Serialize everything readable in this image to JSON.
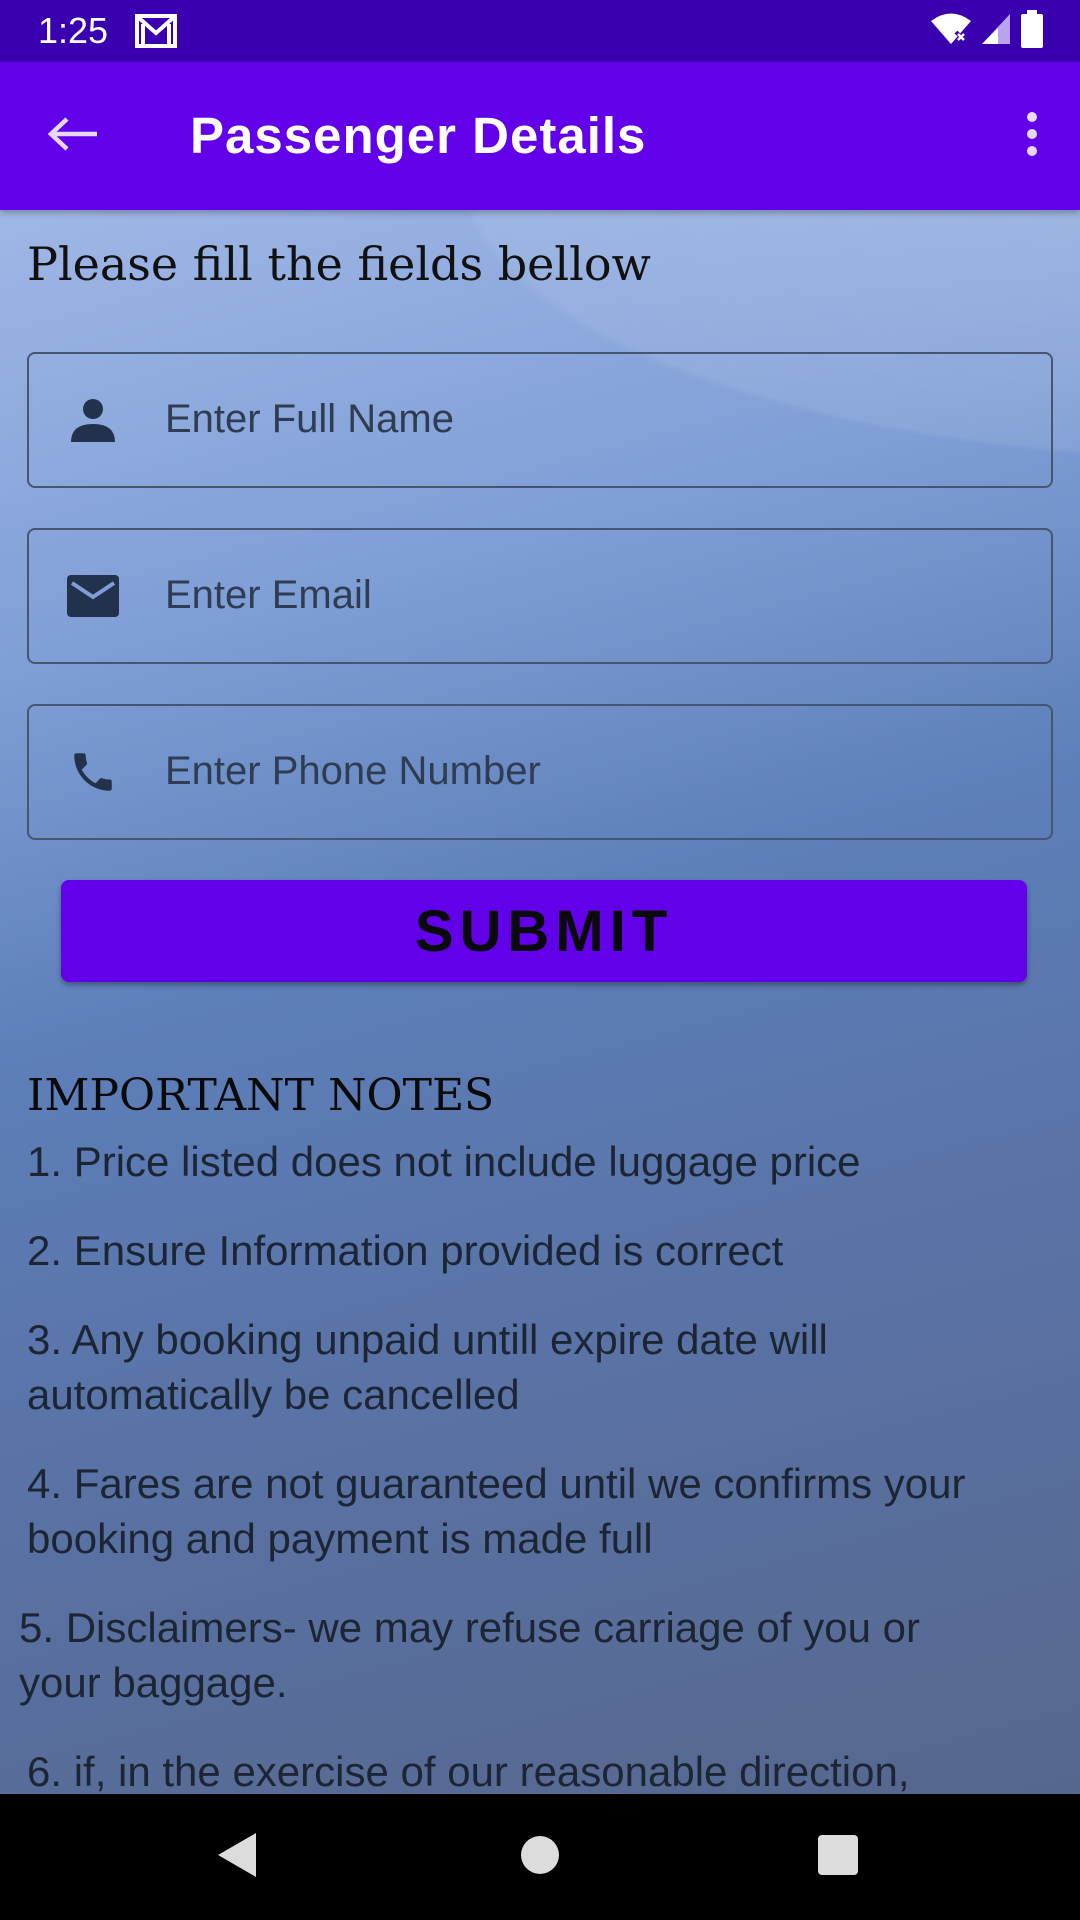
{
  "status_bar": {
    "time": "1:25",
    "icons": [
      "gmail-icon",
      "wifi-icon",
      "signal-icon",
      "battery-icon"
    ]
  },
  "app_bar": {
    "title": "Passenger Details",
    "back_icon": "arrow-back-icon",
    "menu_icon": "more-vert-icon",
    "background_color": "#6200ea"
  },
  "form": {
    "instruction": "Please fill the fields bellow",
    "fields": [
      {
        "icon": "person-icon",
        "placeholder": "Enter Full Name",
        "value": ""
      },
      {
        "icon": "email-icon",
        "placeholder": "Enter Email",
        "value": ""
      },
      {
        "icon": "phone-icon",
        "placeholder": "Enter Phone Number",
        "value": ""
      }
    ],
    "submit_label": "SUBMIT"
  },
  "notes": {
    "heading": "IMPORTANT NOTES",
    "items": [
      {
        "line1": "1. Price listed does not include luggage price",
        "line2": ""
      },
      {
        "line1": "2. Ensure Information provided is correct",
        "line2": ""
      },
      {
        "line1": "3. Any booking unpaid untill expire date will",
        "line2": "automatically be cancelled"
      },
      {
        "line1": "4. Fares are not guaranteed until we confirms your",
        "line2": "booking and payment is made full"
      },
      {
        "line1": "5. Disclaimers- we may refuse carriage of you or",
        "line2": "your baggage."
      },
      {
        "line1": "6. if, in the exercise of our reasonable direction,",
        "line2": ""
      }
    ]
  },
  "nav_bar": {
    "icons": [
      "back-triangle-icon",
      "home-circle-icon",
      "recents-square-icon"
    ]
  }
}
